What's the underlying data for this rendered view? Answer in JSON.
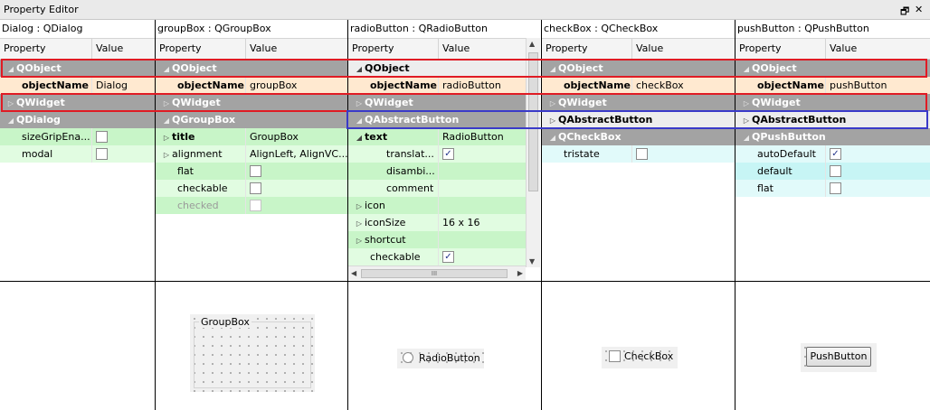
{
  "window": {
    "title": "Property Editor",
    "float_glyph": "🗗",
    "close_glyph": "✕"
  },
  "headers": {
    "property": "Property",
    "value": "Value"
  },
  "check_mark": "✓",
  "columns": {
    "dialog": {
      "title": "Dialog : QDialog",
      "rows": {
        "r0": "QObject",
        "r1": {
          "p": "objectName",
          "v": "Dialog"
        },
        "r2": "QWidget",
        "r3": "QDialog",
        "r4": "sizeGripEna...",
        "r5": "modal"
      }
    },
    "groupbox": {
      "title": "groupBox : QGroupBox",
      "rows": {
        "r0": "QObject",
        "r1": {
          "p": "objectName",
          "v": "groupBox"
        },
        "r2": "QWidget",
        "r3": "QGroupBox",
        "r4": {
          "p": "title",
          "v": "GroupBox"
        },
        "r5": {
          "p": "alignment",
          "v": "AlignLeft, AlignVC..."
        },
        "r6": "flat",
        "r7": "checkable",
        "r8": "checked"
      },
      "preview_label": "GroupBox"
    },
    "radio": {
      "title": "radioButton : QRadioButton",
      "rows": {
        "r0": "QObject",
        "r1": {
          "p": "objectName",
          "v": "radioButton"
        },
        "r2": "QWidget",
        "r3": "QAbstractButton",
        "r4": {
          "p": "text",
          "v": "RadioButton"
        },
        "r5": "translat...",
        "r6": "disambi...",
        "r7": "comment",
        "r8": "icon",
        "r9": {
          "p": "iconSize",
          "v": "16 x 16"
        },
        "r10": "shortcut",
        "r11": "checkable"
      },
      "hscroll_grip": "III",
      "preview_label": "RadioButton"
    },
    "checkbox": {
      "title": "checkBox : QCheckBox",
      "rows": {
        "r0": "QObject",
        "r1": {
          "p": "objectName",
          "v": "checkBox"
        },
        "r2": "QWidget",
        "r3": "QAbstractButton",
        "r4": "QCheckBox",
        "r5": "tristate"
      },
      "preview_label": "CheckBox"
    },
    "pushbutton": {
      "title": "pushButton : QPushButton",
      "rows": {
        "r0": "QObject",
        "r1": {
          "p": "objectName",
          "v": "pushButton"
        },
        "r2": "QWidget",
        "r3": "QAbstractButton",
        "r4": "QPushButton",
        "r5": "autoDefault",
        "r6": "default",
        "r7": "flat"
      },
      "preview_label": "PushButton"
    }
  },
  "colors": {
    "group_header": "#a3a3a3",
    "object_name_row": "#ffe9d0",
    "highlight_red": "#e01b24",
    "highlight_blue": "#3a3ac8"
  }
}
